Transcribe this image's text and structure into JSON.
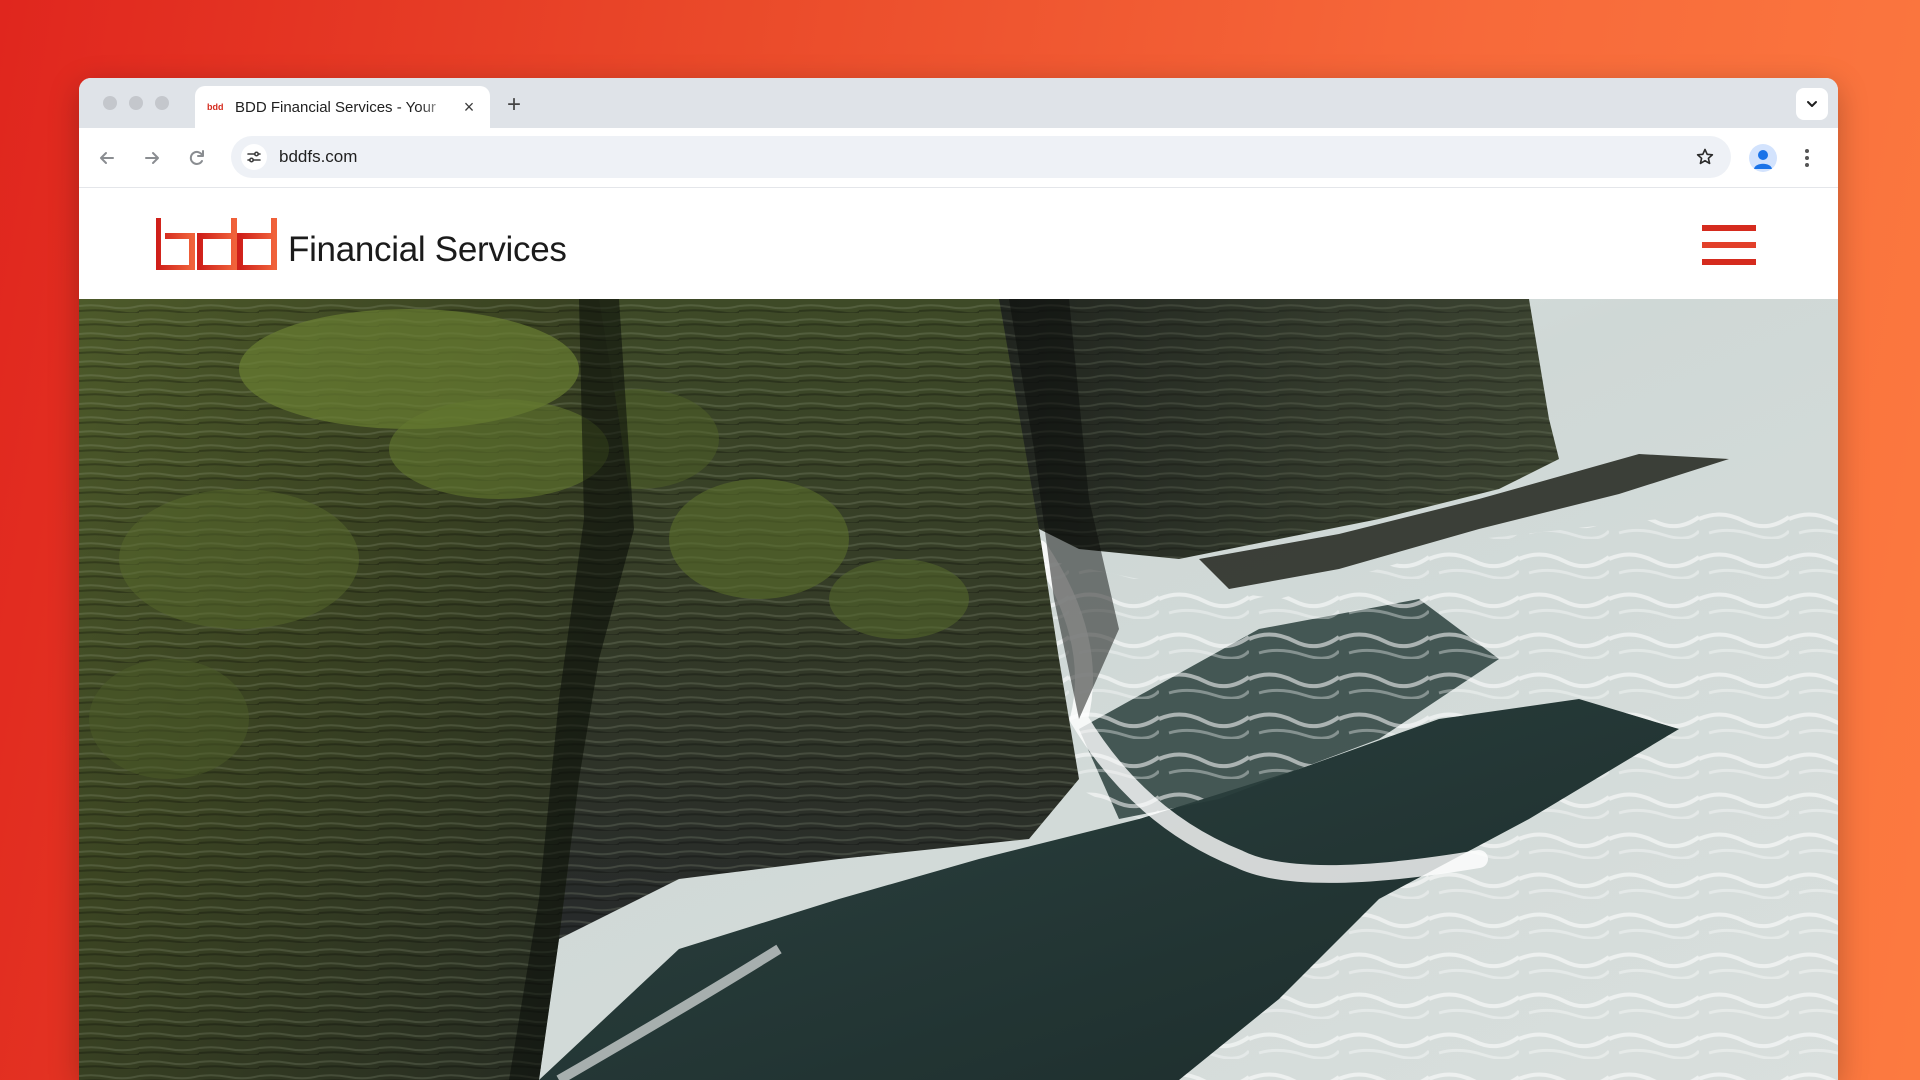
{
  "browser": {
    "tab": {
      "favicon_text": "bdd",
      "title": "BDD Financial Services - Your",
      "close_label": "×"
    },
    "new_tab_label": "+",
    "url": "bddfs.com"
  },
  "site": {
    "logo_mark_text": "bdd",
    "logo_text": "Financial Services",
    "colors": {
      "brand_red": "#d52b1e",
      "brand_orange": "#f0623a"
    }
  },
  "hero": {
    "image_subject": "sea-cliffs-with-crashing-waves"
  },
  "icons": [
    "back-arrow-icon",
    "forward-arrow-icon",
    "reload-icon",
    "site-settings-icon",
    "bookmark-star-icon",
    "profile-icon",
    "more-menu-icon",
    "tab-search-chevron-icon",
    "hamburger-menu-icon"
  ]
}
